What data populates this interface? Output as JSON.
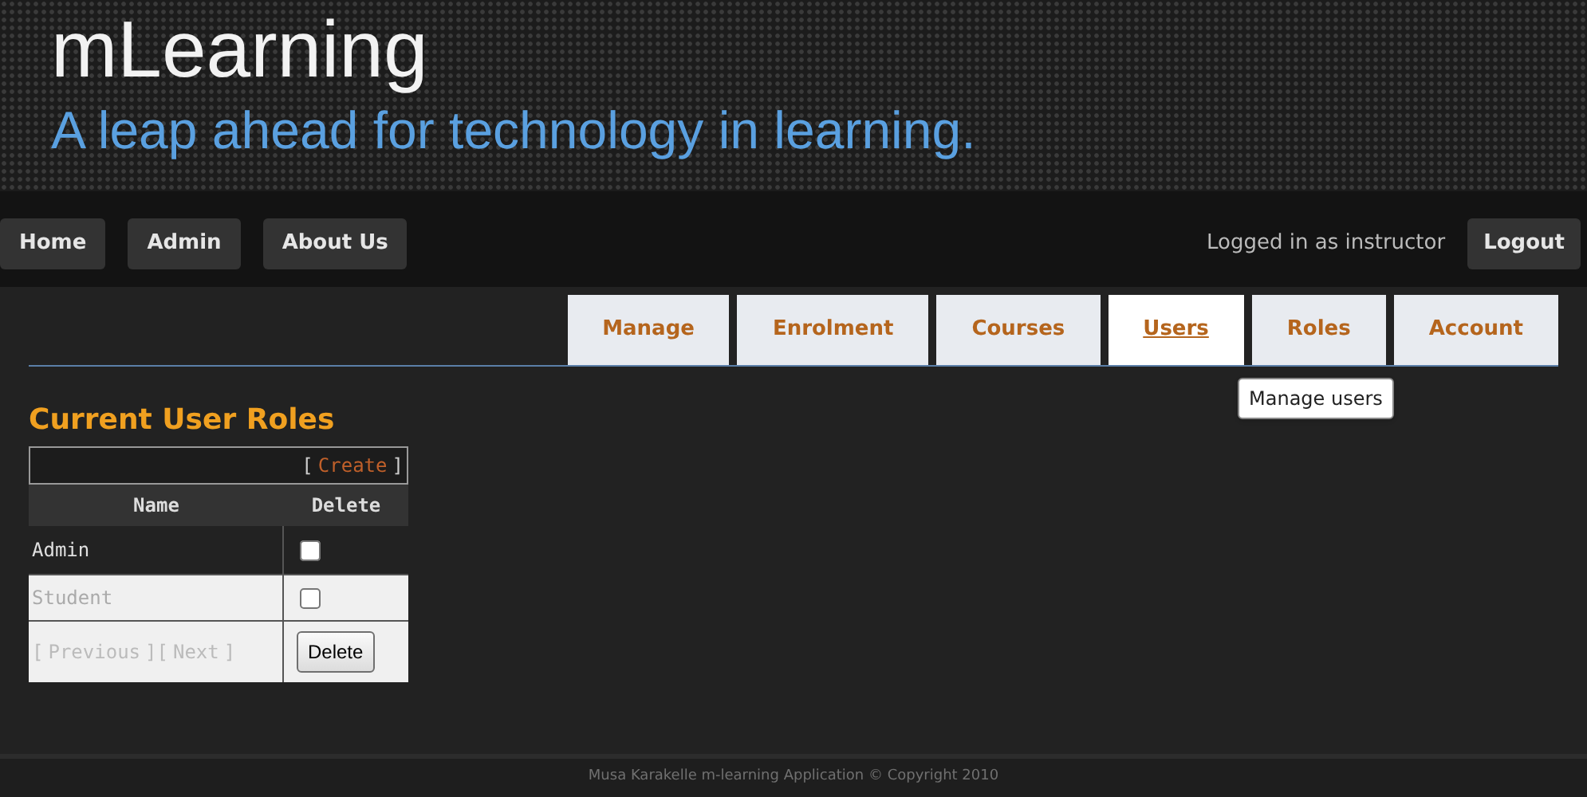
{
  "header": {
    "title": "mLearning",
    "tagline": "A leap ahead for technology in learning."
  },
  "nav": {
    "items": [
      {
        "label": "Home"
      },
      {
        "label": "Admin"
      },
      {
        "label": "About Us"
      }
    ],
    "status": "Logged in as instructor",
    "logout": "Logout"
  },
  "tabs": [
    {
      "label": "Manage",
      "selected": false
    },
    {
      "label": "Enrolment",
      "selected": false
    },
    {
      "label": "Courses",
      "selected": false
    },
    {
      "label": "Users",
      "selected": true
    },
    {
      "label": "Roles",
      "selected": false
    },
    {
      "label": "Account",
      "selected": false
    }
  ],
  "tooltip": "Manage users",
  "section_title": "Current User Roles",
  "table": {
    "create_open": "[",
    "create_link": "Create",
    "create_close": "]",
    "columns": [
      "Name",
      "Delete"
    ],
    "rows": [
      {
        "name": "Admin",
        "checked": false
      },
      {
        "name": "Student",
        "checked": false
      }
    ],
    "pager_open": "[",
    "previous": "Previous",
    "pager_between": "][",
    "next": "Next",
    "pager_close": "]",
    "delete_button": "Delete"
  },
  "footer": "Musa Karakelle m-learning Application © Copyright 2010"
}
